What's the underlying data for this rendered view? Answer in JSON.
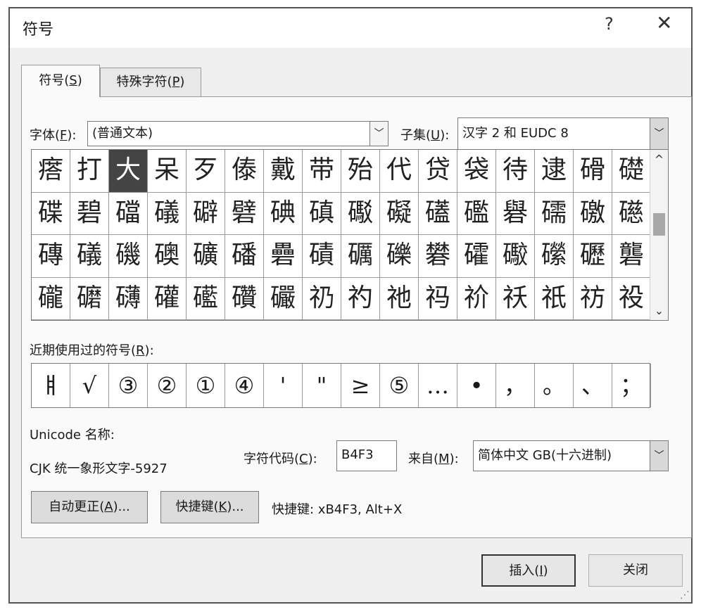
{
  "dialog": {
    "title": "符号",
    "help_label": "?",
    "close_label": "✕"
  },
  "tabs": [
    {
      "label": "符号(",
      "key": "S",
      "suffix": ")"
    },
    {
      "label": "特殊字符(",
      "key": "P",
      "suffix": ")"
    }
  ],
  "font": {
    "label": "字体(",
    "key": "F",
    "suffix": "):",
    "value": "(普通文本)"
  },
  "subset": {
    "label": "子集(",
    "key": "U",
    "suffix": "):",
    "value": "汉字 2 和 EUDC 8"
  },
  "grid": [
    [
      "瘩",
      "打",
      "大",
      "呆",
      "歹",
      "傣",
      "戴",
      "带",
      "殆",
      "代",
      "贷",
      "袋",
      "待",
      "逮",
      "磆",
      "礎"
    ],
    [
      "碟",
      "碧",
      "礑",
      "礒",
      "礔",
      "礕",
      "碘",
      "磌",
      "礟",
      "礙",
      "礚",
      "礛",
      "礜",
      "礝",
      "礉",
      "礠"
    ],
    [
      "磚",
      "礒",
      "磯",
      "礇",
      "礦",
      "磻",
      "礨",
      "磧",
      "礪",
      "礫",
      "礬",
      "礭",
      "礮",
      "礯",
      "礰",
      "礱"
    ],
    [
      "礲",
      "礳",
      "礴",
      "礶",
      "礷",
      "礸",
      "礹",
      "礽",
      "礿",
      "祂",
      "祃",
      "祄",
      "祅",
      "祇",
      "祊",
      "祋"
    ]
  ],
  "selected": {
    "row": 0,
    "col": 2
  },
  "recent": {
    "label": "近期使用过的符号(",
    "key": "R",
    "suffix": "):",
    "symbols": [
      "ㅒ",
      "√",
      "③",
      "②",
      "①",
      "④",
      "'",
      "\"",
      "≥",
      "⑤",
      "…",
      "•",
      "，",
      "。",
      "、",
      "；"
    ]
  },
  "unicode_name_label": "Unicode 名称:",
  "unicode_name_value": "CJK 统一象形文字-5927",
  "char_code": {
    "label": "字符代码(",
    "key": "C",
    "suffix": "):",
    "value": "B4F3"
  },
  "from": {
    "label": "来自(",
    "key": "M",
    "suffix": "):",
    "value": "简体中文 GB(十六进制)"
  },
  "autocorrect_button": {
    "label": "自动更正(",
    "key": "A",
    "suffix": ")..."
  },
  "shortcut_button": {
    "label": "快捷键(",
    "key": "K",
    "suffix": ")..."
  },
  "shortcut_text": "快捷键: xB4F3, Alt+X",
  "insert_button": {
    "label": "插入(",
    "key": "I",
    "suffix": ")"
  },
  "close_button": {
    "label": "关闭"
  }
}
